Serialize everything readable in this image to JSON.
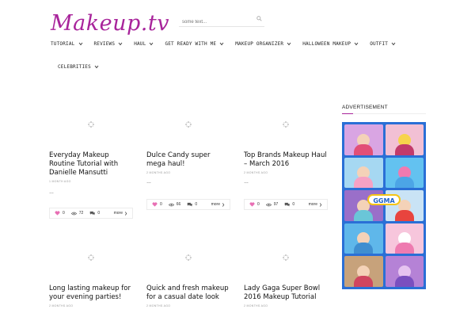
{
  "site": {
    "logo": "Makeup.tv"
  },
  "search": {
    "placeholder": "some text..."
  },
  "nav": {
    "row1": [
      "TUTORIAL",
      "REVIEWS",
      "HAUL",
      "GET READY WITH ME",
      "MAKEUP ORGANIZER",
      "HALLOWEEN MAKEUP",
      "OUTFIT"
    ],
    "row2": [
      "CELEBRITIES"
    ]
  },
  "posts": [
    {
      "title": "Everyday Makeup Routine Tutorial with Danielle Mansutti",
      "date": "1 MONTH AGO",
      "excerpt": "…",
      "likes": "0",
      "views": "72",
      "comments": "0",
      "more": "more"
    },
    {
      "title": "Dulce Candy super mega haul!",
      "date": "2 MONTHS AGO",
      "excerpt": "…",
      "likes": "0",
      "views": "66",
      "comments": "0",
      "more": "more"
    },
    {
      "title": "Top Brands Makeup Haul – March 2016",
      "date": "2 MONTHS AGO",
      "excerpt": "…",
      "likes": "0",
      "views": "97",
      "comments": "0",
      "more": "more"
    },
    {
      "title": "Long lasting makeup for your evening parties!",
      "date": "2 MONTHS AGO"
    },
    {
      "title": "Quick and fresh makeup for a casual date look",
      "date": "2 MONTHS AGO"
    },
    {
      "title": "Lady Gaga Super Bowl 2016 Makeup Tutorial",
      "date": "2 MONTHS AGO"
    }
  ],
  "sidebar": {
    "ad_heading": "ADVERTISEMENT",
    "ad_logo": "GGMA"
  },
  "colors": {
    "brand": "#a8249b",
    "like": "#e86fb4",
    "ad_bg": "#2a6fd6"
  }
}
